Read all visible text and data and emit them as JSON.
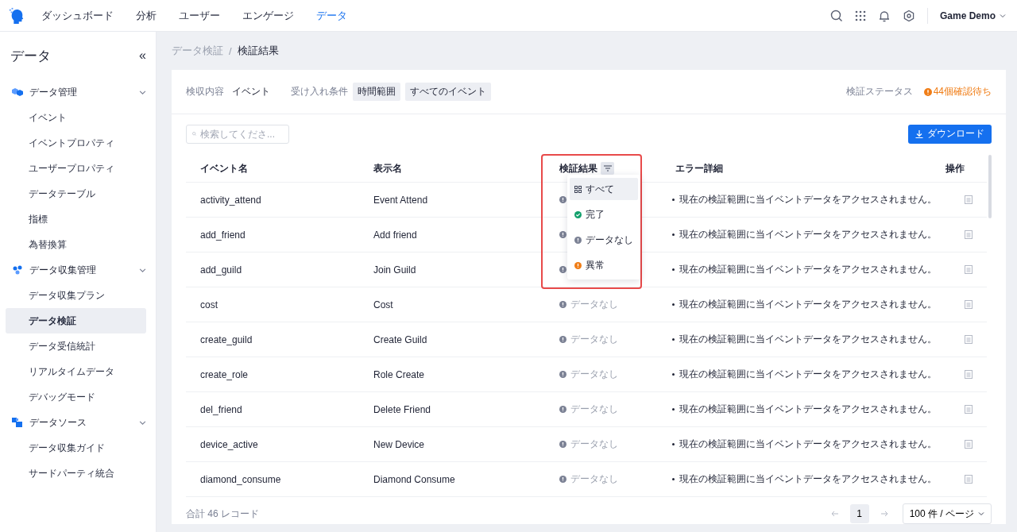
{
  "topnav": {
    "items": [
      {
        "label": "ダッシュボード",
        "selected": false
      },
      {
        "label": "分析",
        "selected": false
      },
      {
        "label": "ユーザー",
        "selected": false
      },
      {
        "label": "エンゲージ",
        "selected": false
      },
      {
        "label": "データ",
        "selected": true
      }
    ],
    "project": "Game Demo"
  },
  "sidebar": {
    "title": "データ",
    "collapse": "«",
    "groups": [
      {
        "label": "データ管理",
        "kind": "cubes",
        "expanded": true,
        "items": [
          {
            "label": "イベント",
            "selected": false
          },
          {
            "label": "イベントプロパティ",
            "selected": false
          },
          {
            "label": "ユーザープロパティ",
            "selected": false
          },
          {
            "label": "データテーブル",
            "selected": false
          },
          {
            "label": "指標",
            "selected": false
          },
          {
            "label": "為替換算",
            "selected": false
          }
        ]
      },
      {
        "label": "データ収集管理",
        "kind": "dots",
        "expanded": true,
        "items": [
          {
            "label": "データ収集プラン",
            "selected": false
          },
          {
            "label": "データ検証",
            "selected": true
          },
          {
            "label": "データ受信統計",
            "selected": false
          },
          {
            "label": "リアルタイムデータ",
            "selected": false
          },
          {
            "label": "デバッグモード",
            "selected": false
          }
        ]
      },
      {
        "label": "データソース",
        "kind": "squares",
        "expanded": true,
        "items": [
          {
            "label": "データ収集ガイド",
            "selected": false
          },
          {
            "label": "サードパーティ統合",
            "selected": false
          }
        ]
      }
    ]
  },
  "breadcrumb": [
    "データ検証",
    "検証結果"
  ],
  "breadcrumb_separator": "/",
  "conditions": {
    "content_label": "検収内容",
    "content_value": "イベント",
    "accept_label": "受け入れ条件",
    "tags": [
      "時間範囲",
      "すべてのイベント"
    ],
    "status_label": "検証ステータス",
    "status_value": "44個確認待ち"
  },
  "search": {
    "placeholder": "検索してくださ..."
  },
  "download_button": "ダウンロード",
  "table": {
    "columns": [
      "イベント名",
      "表示名",
      "検証結果",
      "エラー詳細",
      "操作"
    ],
    "rows": [
      {
        "event": "activity_attend",
        "display": "Event Attend",
        "status": {
          "kind": "nodata"
        },
        "error": "現在の検証範囲に当イベントデータをアクセスされません。"
      },
      {
        "event": "add_friend",
        "display": "Add friend",
        "status": {
          "kind": "nodata"
        },
        "error": "現在の検証範囲に当イベントデータをアクセスされません。"
      },
      {
        "event": "add_guild",
        "display": "Join Guild",
        "status": {
          "kind": "nodata"
        },
        "error": "現在の検証範囲に当イベントデータをアクセスされません。"
      },
      {
        "event": "cost",
        "display": "Cost",
        "status": {
          "kind": "nodata",
          "text": "データなし"
        },
        "error": "現在の検証範囲に当イベントデータをアクセスされません。"
      },
      {
        "event": "create_guild",
        "display": "Create Guild",
        "status": {
          "kind": "nodata",
          "text": "データなし"
        },
        "error": "現在の検証範囲に当イベントデータをアクセスされません。"
      },
      {
        "event": "create_role",
        "display": "Role Create",
        "status": {
          "kind": "nodata",
          "text": "データなし"
        },
        "error": "現在の検証範囲に当イベントデータをアクセスされません。"
      },
      {
        "event": "del_friend",
        "display": "Delete Friend",
        "status": {
          "kind": "nodata",
          "text": "データなし"
        },
        "error": "現在の検証範囲に当イベントデータをアクセスされません。"
      },
      {
        "event": "device_active",
        "display": "New Device",
        "status": {
          "kind": "nodata",
          "text": "データなし"
        },
        "error": "現在の検証範囲に当イベントデータをアクセスされません。"
      },
      {
        "event": "diamond_consume",
        "display": "Diamond Consume",
        "status": {
          "kind": "nodata",
          "text": "データなし"
        },
        "error": "現在の検証範囲に当イベントデータをアクセスされません。"
      }
    ]
  },
  "filter_menu": {
    "highlighted": true,
    "options": [
      {
        "label": "すべて",
        "kind": "all",
        "selected": true
      },
      {
        "label": "完了",
        "kind": "done",
        "selected": false
      },
      {
        "label": "データなし",
        "kind": "nodata",
        "selected": false
      },
      {
        "label": "異常",
        "kind": "error",
        "selected": false
      }
    ]
  },
  "footer": {
    "total": "合計 46 レコード",
    "pages": [
      {
        "label": "1",
        "selected": true
      }
    ],
    "page_size": "100 件 / ページ"
  }
}
